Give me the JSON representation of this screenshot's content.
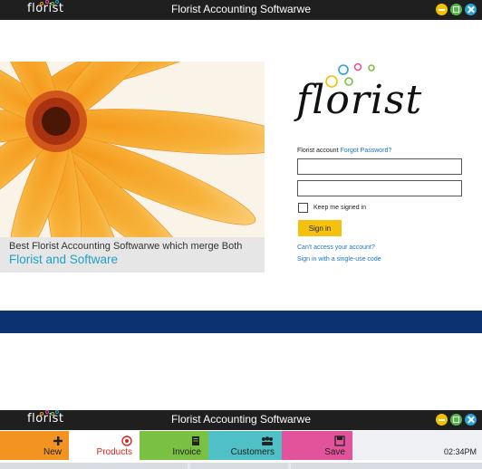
{
  "window1": {
    "title": "Florist Accounting Softwarwe",
    "logo_text": "florist"
  },
  "hero": {
    "line1": "Best Florist Accounting Softwarwe which merge Both",
    "line2": "Florist and Software"
  },
  "brand": {
    "logo_text": "florist"
  },
  "login": {
    "account_label": "Florist account",
    "forgot_link": "Forgot Password?",
    "keep_signed_in": "Keep me signed in",
    "signin_button": "Sign in",
    "cant_access": "Can't access your account?",
    "single_use": "Sign in with a single-use code"
  },
  "window2": {
    "title": "Florist Accounting Softwarwe",
    "logo_text": "florist",
    "time": "02:34PM",
    "tabs": [
      {
        "label": "New",
        "icon": "plus-icon",
        "color": "#f39322"
      },
      {
        "label": "Products",
        "icon": "products-icon",
        "color": "#ffffff"
      },
      {
        "label": "Invoice",
        "icon": "invoice-icon",
        "color": "#7ac143"
      },
      {
        "label": "Customers",
        "icon": "customers-icon",
        "color": "#4fc0c6"
      },
      {
        "label": "Save",
        "icon": "save-icon",
        "color": "#e3539b"
      }
    ]
  },
  "colors": {
    "accent_blue": "#1ea0c7",
    "nav_blue": "#0d3272",
    "signin_yellow": "#f4c20d"
  }
}
